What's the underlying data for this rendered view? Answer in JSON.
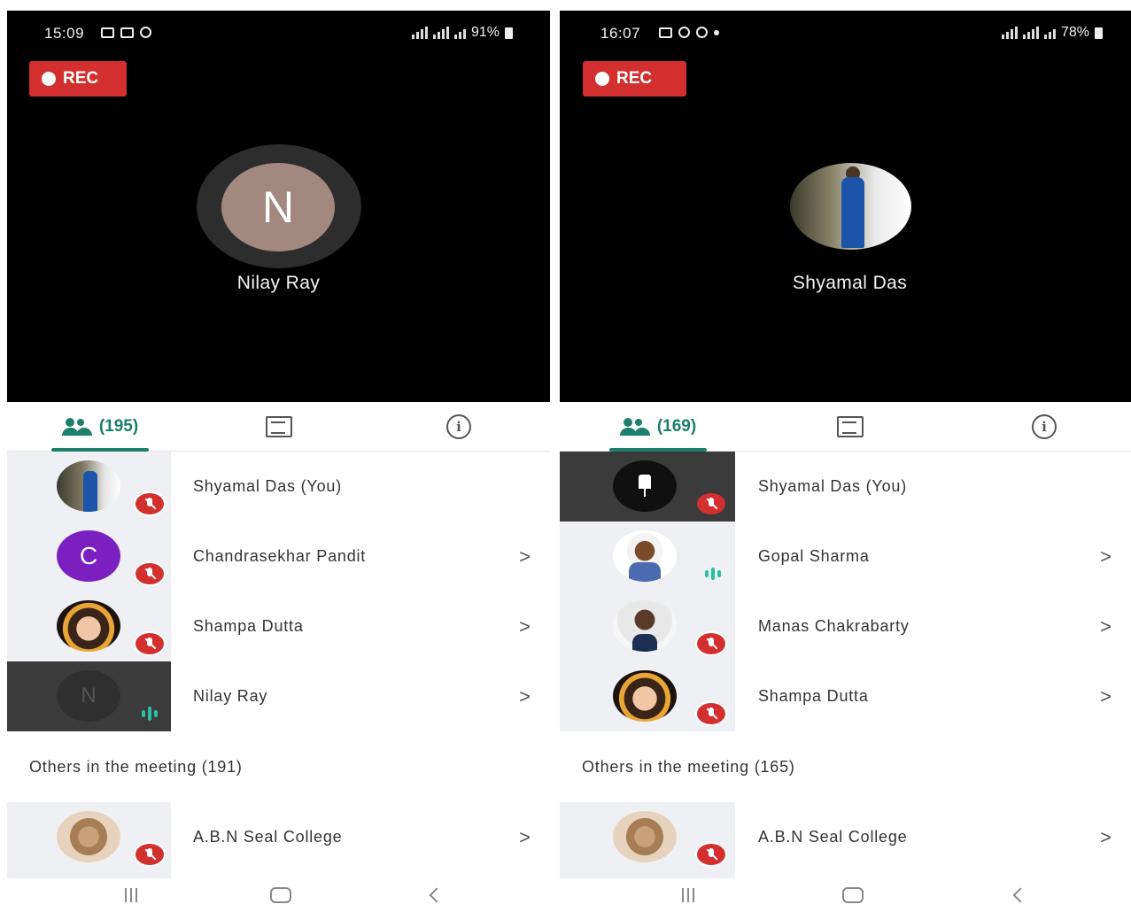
{
  "left": {
    "status": {
      "time": "15:09",
      "battery": "91%"
    },
    "rec_label": "REC",
    "presenter": {
      "initial": "N",
      "name": "Nilay Ray"
    },
    "tabs": {
      "people_count": "(195)"
    },
    "participants": [
      {
        "name": "Shyamal Das (You)",
        "avatar": "photo-man",
        "mic": "muted",
        "chevron": false
      },
      {
        "name": "Chandrasekhar Pandit",
        "avatar": "letter",
        "initial": "C",
        "mic": "muted",
        "chevron": true
      },
      {
        "name": "Shampa Dutta",
        "avatar": "photo-woman",
        "mic": "muted",
        "chevron": true
      },
      {
        "name": "Nilay Ray",
        "avatar": "letter",
        "initial": "N",
        "mic": "talking",
        "chevron": true
      }
    ],
    "others_header": "Others in the meeting (191)",
    "others": [
      {
        "name": "A.B.N Seal College",
        "avatar": "photo-college",
        "mic": "muted",
        "chevron": true
      }
    ]
  },
  "right": {
    "status": {
      "time": "16:07",
      "battery": "78%"
    },
    "rec_label": "REC",
    "presenter": {
      "name": "Shyamal Das"
    },
    "tabs": {
      "people_count": "(169)"
    },
    "participants": [
      {
        "name": "Shyamal Das (You)",
        "avatar": "pin",
        "mic": "muted",
        "chevron": false
      },
      {
        "name": "Gopal Sharma",
        "avatar": "photo-man",
        "mic": "talking",
        "chevron": true
      },
      {
        "name": "Manas Chakrabarty",
        "avatar": "photo-man-old",
        "mic": "muted",
        "chevron": true
      },
      {
        "name": "Shampa Dutta",
        "avatar": "photo-woman",
        "mic": "muted",
        "chevron": true
      }
    ],
    "others_header": "Others in the meeting (165)",
    "others": [
      {
        "name": "A.B.N Seal College",
        "avatar": "photo-college",
        "mic": "muted",
        "chevron": true
      }
    ]
  },
  "colors": {
    "accent": "#1b7f6a",
    "rec": "#d32f2f",
    "mute": "#d32f2f",
    "talk": "#27c0a0"
  },
  "icons": {
    "tab_people": "people-icon",
    "tab_chat": "chat-icon",
    "tab_info": "info-icon",
    "mute": "mic-off-icon",
    "talking": "audio-level-icon",
    "chevron": "chevron-right-icon",
    "nav": [
      "recent-apps-icon",
      "home-icon",
      "back-icon"
    ]
  }
}
